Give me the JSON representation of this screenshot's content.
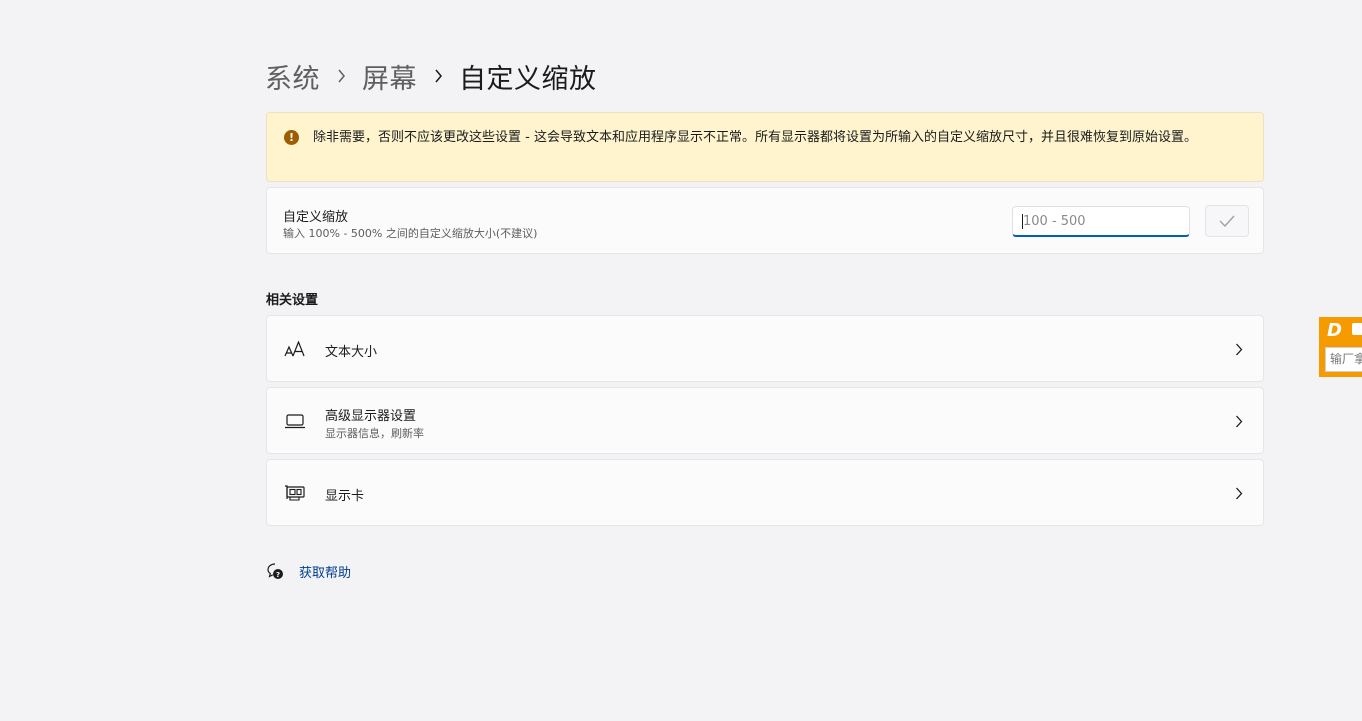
{
  "breadcrumb": {
    "items": [
      "系统",
      "屏幕"
    ],
    "current": "自定义缩放"
  },
  "warning": {
    "icon": "warning-icon",
    "text": "除非需要，否则不应该更改这些设置 - 这会导致文本和应用程序显示不正常。所有显示器都将设置为所输入的自定义缩放尺寸，并且很难恢复到原始设置。"
  },
  "custom_scaling": {
    "title": "自定义缩放",
    "description": "输入 100% - 500% 之间的自定义缩放大小(不建议)",
    "input_value": "",
    "input_placeholder": "100 - 500",
    "apply_icon": "checkmark-icon"
  },
  "related": {
    "heading": "相关设置",
    "items": [
      {
        "title": "文本大小",
        "subtitle": "",
        "icon": "text-size-icon"
      },
      {
        "title": "高级显示器设置",
        "subtitle": "显示器信息，刷新率",
        "icon": "laptop-icon"
      },
      {
        "title": "显示卡",
        "subtitle": "",
        "icon": "graphics-card-icon"
      }
    ]
  },
  "help": {
    "label": "获取帮助",
    "icon": "help-chat-icon"
  },
  "ime": {
    "logo": "D",
    "placeholder": "输厂拿"
  },
  "colors": {
    "accent": "#005fb8",
    "warning_bg": "#fff4ce",
    "warning_icon": "#9d5d00",
    "link": "#003e92",
    "ime_orange": "#f59b00"
  }
}
